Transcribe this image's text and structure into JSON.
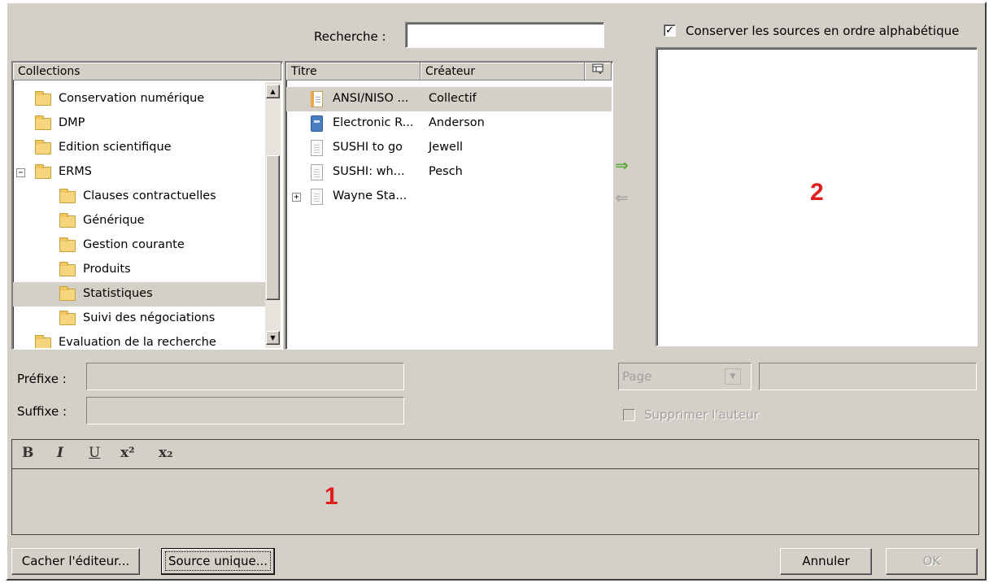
{
  "search": {
    "label": "Recherche :",
    "value": ""
  },
  "sort_option": {
    "label": "Conserver les sources en ordre alphabétique",
    "checked": true
  },
  "collections": {
    "header": "Collections",
    "items": [
      {
        "label": "Conservation numérique"
      },
      {
        "label": "DMP"
      },
      {
        "label": "Edition scientifique"
      },
      {
        "label": "ERMS",
        "expander": "−"
      },
      {
        "label": "Clauses contractuelles"
      },
      {
        "label": "Générique"
      },
      {
        "label": "Gestion courante"
      },
      {
        "label": "Produits"
      },
      {
        "label": "Statistiques"
      },
      {
        "label": "Suivi des négociations"
      },
      {
        "label": "Evaluation de la recherche"
      }
    ]
  },
  "items_table": {
    "columns": {
      "title": "Titre",
      "creator": "Créateur"
    },
    "rows": [
      {
        "title": "ANSI/NISO ...",
        "creator": "Collectif",
        "icon": "report-icon"
      },
      {
        "title": "Electronic R...",
        "creator": "Anderson",
        "icon": "book-icon"
      },
      {
        "title": "SUSHI to go",
        "creator": "Jewell",
        "icon": "document-icon"
      },
      {
        "title": "SUSHI: wh...",
        "creator": "Pesch",
        "icon": "document-icon"
      },
      {
        "title": "Wayne Sta...",
        "creator": "",
        "icon": "document-icon",
        "expander": "+"
      }
    ]
  },
  "transfer": {
    "add": "⇒",
    "remove": "⇐"
  },
  "annotations": {
    "editor": "1",
    "sources": "2"
  },
  "prefix": {
    "label": "Préfixe :",
    "value": ""
  },
  "suffix": {
    "label": "Suffixe :",
    "value": ""
  },
  "locator": {
    "selected": "Page",
    "value": ""
  },
  "suppress_author": {
    "label": "Supprimer l'auteur",
    "checked": false
  },
  "editor_toolbar": {
    "bold": "B",
    "italic": "I",
    "underline": "U",
    "superscript": "x²",
    "subscript": "x₂"
  },
  "buttons": {
    "hide_editor": "Cacher l'éditeur...",
    "single_source": "Source unique...",
    "cancel": "Annuler",
    "ok": "OK"
  },
  "colors": {
    "annotation": "#e11d1d",
    "dialog_bg": "#d4d0c8",
    "selection": "#d4d0c8"
  }
}
